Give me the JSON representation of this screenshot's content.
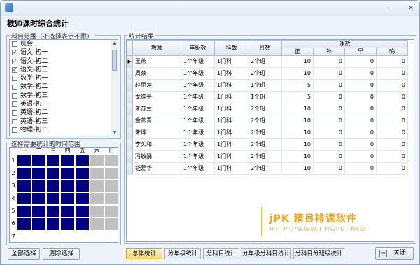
{
  "window": {
    "title": "",
    "heading": "教师课时综合统计",
    "minimize": "–",
    "close": "×"
  },
  "subjects": {
    "group_label": "科目范围（不选择表示不限）",
    "items": [
      {
        "label": "班会",
        "checked": false
      },
      {
        "label": "语文-初一",
        "checked": true
      },
      {
        "label": "语文-初二",
        "checked": true
      },
      {
        "label": "语文-初三",
        "checked": true
      },
      {
        "label": "数学-初一",
        "checked": false
      },
      {
        "label": "数学-初二",
        "checked": false
      },
      {
        "label": "数学-初三",
        "checked": false
      },
      {
        "label": "英语-初一",
        "checked": false
      },
      {
        "label": "英语-初二",
        "checked": false
      },
      {
        "label": "英语-初三",
        "checked": false
      },
      {
        "label": "物理-初二",
        "checked": false
      }
    ]
  },
  "timegrid": {
    "group_label": "选择需要统计的时间范围",
    "days": [
      "一",
      "二",
      "三",
      "四",
      "五",
      "六",
      "日"
    ],
    "periods": [
      "1",
      "2",
      "3",
      "4",
      "5",
      "6",
      "7"
    ]
  },
  "left_buttons": {
    "select_all": "全部选择",
    "clear": "清除选择"
  },
  "results": {
    "group_label": "统计结果",
    "columns": {
      "teacher": "教师",
      "grades": "年级数",
      "subjects": "科数",
      "classes": "班数",
      "hours": "课数",
      "zheng": "正",
      "bu": "补",
      "zao": "早",
      "wan": "晚"
    },
    "rows": [
      {
        "teacher": "王燕",
        "grades": "1个年级",
        "subjects": "1门科",
        "classes": "2个班",
        "zheng": "10",
        "bu": "0",
        "zao": "0",
        "wan": "0"
      },
      {
        "teacher": "周燚",
        "grades": "1个年级",
        "subjects": "1门科",
        "classes": "2个班",
        "zheng": "10",
        "bu": "0",
        "zao": "0",
        "wan": "0"
      },
      {
        "teacher": "赵丽萍",
        "grades": "1个年级",
        "subjects": "1门科",
        "classes": "1个班",
        "zheng": "5",
        "bu": "0",
        "zao": "0",
        "wan": "0"
      },
      {
        "teacher": "戈维平",
        "grades": "1个年级",
        "subjects": "1门科",
        "classes": "1个班",
        "zheng": "5",
        "bu": "0",
        "zao": "0",
        "wan": "0"
      },
      {
        "teacher": "朱苏兰",
        "grades": "1个年级",
        "subjects": "1门科",
        "classes": "2个班",
        "zheng": "10",
        "bu": "0",
        "zao": "0",
        "wan": "0"
      },
      {
        "teacher": "金燕青",
        "grades": "1个年级",
        "subjects": "1门科",
        "classes": "2个班",
        "zheng": "10",
        "bu": "0",
        "zao": "0",
        "wan": "0"
      },
      {
        "teacher": "朱烨",
        "grades": "1个年级",
        "subjects": "1门科",
        "classes": "2个班",
        "zheng": "10",
        "bu": "0",
        "zao": "0",
        "wan": "0"
      },
      {
        "teacher": "李久和",
        "grades": "1个年级",
        "subjects": "1门科",
        "classes": "2个班",
        "zheng": "10",
        "bu": "0",
        "zao": "0",
        "wan": "0"
      },
      {
        "teacher": "冯敏娟",
        "grades": "1个年级",
        "subjects": "1门科",
        "classes": "2个班",
        "zheng": "10",
        "bu": "0",
        "zao": "0",
        "wan": "0"
      },
      {
        "teacher": "钱爱华",
        "grades": "1个年级",
        "subjects": "1门科",
        "classes": "2个班",
        "zheng": "10",
        "bu": "0",
        "zao": "0",
        "wan": "0"
      }
    ]
  },
  "tabs": [
    "总体统计",
    "分年级统计",
    "分科目统计",
    "分年级分科目统计",
    "分科目分班级统计"
  ],
  "logo": {
    "title": "jPK 精良排课软件",
    "url": "HTTP://WWW.JINGPK.INFO"
  },
  "close_button": {
    "label": "关闭"
  }
}
